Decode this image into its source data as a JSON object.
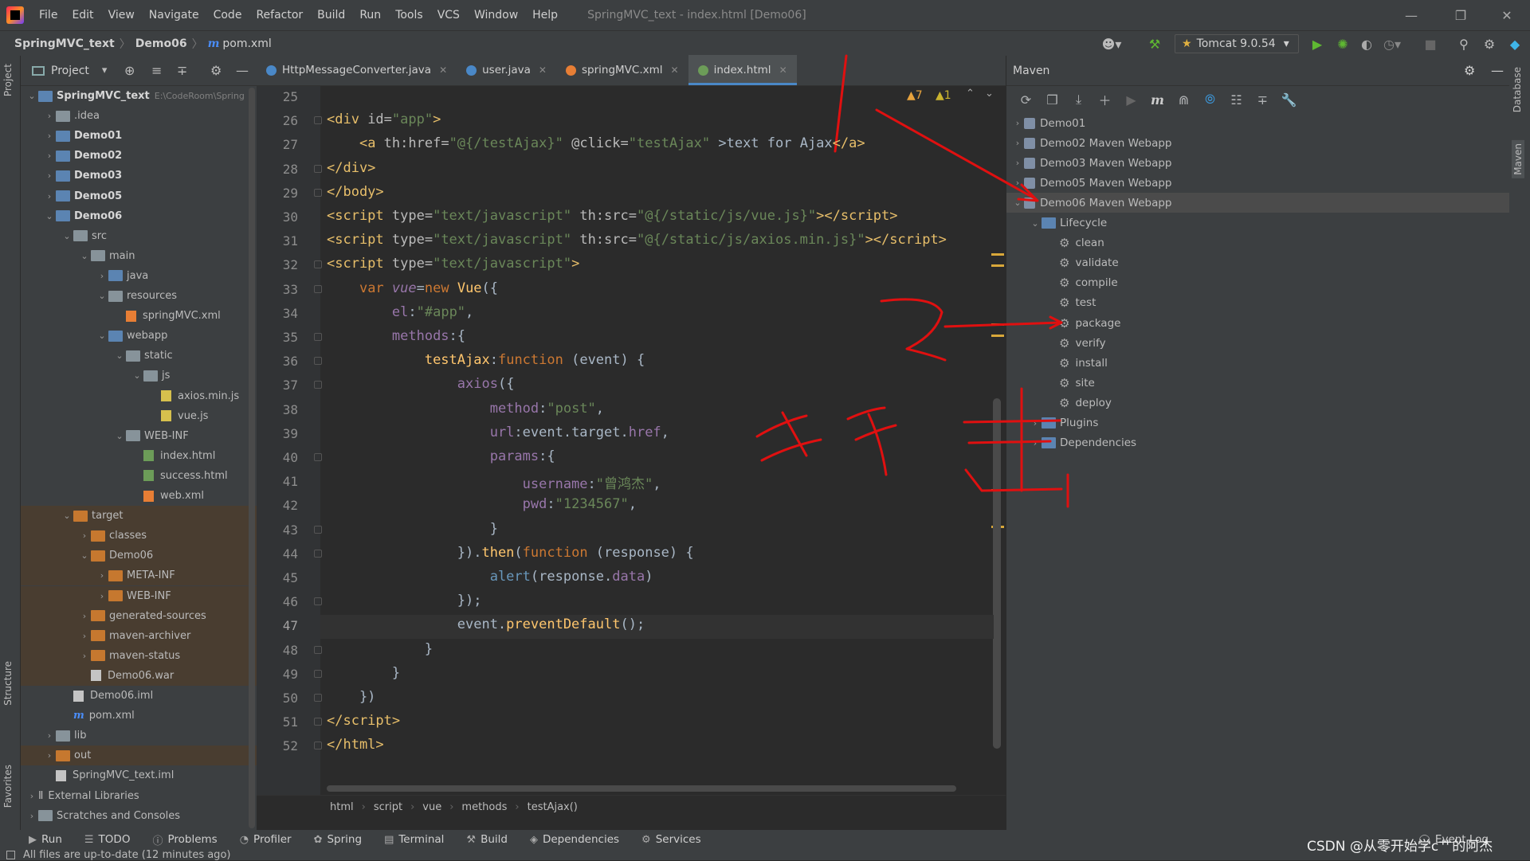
{
  "menu": {
    "items": [
      "File",
      "Edit",
      "View",
      "Navigate",
      "Code",
      "Refactor",
      "Build",
      "Run",
      "Tools",
      "VCS",
      "Window",
      "Help"
    ],
    "title": "SpringMVC_text - index.html [Demo06]"
  },
  "navbar": {
    "crumbs": [
      "SpringMVC_text",
      "Demo06",
      "pom.xml"
    ],
    "run_config": "Tomcat 9.0.54"
  },
  "project": {
    "header": "Project",
    "rows": [
      {
        "label": "SpringMVC_text",
        "extra": "E:\\CodeRoom\\Spring",
        "indent": 0,
        "arrow": "v",
        "icon": "folder-blue",
        "bold": true
      },
      {
        "label": ".idea",
        "indent": 1,
        "arrow": ">",
        "icon": "folder"
      },
      {
        "label": "Demo01",
        "indent": 1,
        "arrow": ">",
        "icon": "folder-blue",
        "bold": true
      },
      {
        "label": "Demo02",
        "indent": 1,
        "arrow": ">",
        "icon": "folder-blue",
        "bold": true
      },
      {
        "label": "Demo03",
        "indent": 1,
        "arrow": ">",
        "icon": "folder-blue",
        "bold": true
      },
      {
        "label": "Demo05",
        "indent": 1,
        "arrow": ">",
        "icon": "folder-blue",
        "bold": true
      },
      {
        "label": "Demo06",
        "indent": 1,
        "arrow": "v",
        "icon": "folder-blue",
        "bold": true
      },
      {
        "label": "src",
        "indent": 2,
        "arrow": "v",
        "icon": "folder"
      },
      {
        "label": "main",
        "indent": 3,
        "arrow": "v",
        "icon": "folder"
      },
      {
        "label": "java",
        "indent": 4,
        "arrow": ">",
        "icon": "folder-blue"
      },
      {
        "label": "resources",
        "indent": 4,
        "arrow": "v",
        "icon": "folder"
      },
      {
        "label": "springMVC.xml",
        "indent": 5,
        "arrow": "",
        "icon": "xml"
      },
      {
        "label": "webapp",
        "indent": 4,
        "arrow": "v",
        "icon": "folder-blue"
      },
      {
        "label": "static",
        "indent": 5,
        "arrow": "v",
        "icon": "folder"
      },
      {
        "label": "js",
        "indent": 6,
        "arrow": "v",
        "icon": "folder"
      },
      {
        "label": "axios.min.js",
        "indent": 7,
        "arrow": "",
        "icon": "js"
      },
      {
        "label": "vue.js",
        "indent": 7,
        "arrow": "",
        "icon": "js"
      },
      {
        "label": "WEB-INF",
        "indent": 5,
        "arrow": "v",
        "icon": "folder"
      },
      {
        "label": "index.html",
        "indent": 6,
        "arrow": "",
        "icon": "html"
      },
      {
        "label": "success.html",
        "indent": 6,
        "arrow": "",
        "icon": "html"
      },
      {
        "label": "web.xml",
        "indent": 6,
        "arrow": "",
        "icon": "xml"
      },
      {
        "label": "target",
        "indent": 2,
        "arrow": "v",
        "icon": "folder-orange",
        "excl": true
      },
      {
        "label": "classes",
        "indent": 3,
        "arrow": ">",
        "icon": "folder-orange",
        "excl": true
      },
      {
        "label": "Demo06",
        "indent": 3,
        "arrow": "v",
        "icon": "folder-orange",
        "excl": true
      },
      {
        "label": "META-INF",
        "indent": 4,
        "arrow": ">",
        "icon": "folder-orange",
        "excl": true
      },
      {
        "label": "WEB-INF",
        "indent": 4,
        "arrow": ">",
        "icon": "folder-orange",
        "excl": true
      },
      {
        "label": "generated-sources",
        "indent": 3,
        "arrow": ">",
        "icon": "folder-orange",
        "excl": true
      },
      {
        "label": "maven-archiver",
        "indent": 3,
        "arrow": ">",
        "icon": "folder-orange",
        "excl": true
      },
      {
        "label": "maven-status",
        "indent": 3,
        "arrow": ">",
        "icon": "folder-orange",
        "excl": true
      },
      {
        "label": "Demo06.war",
        "indent": 3,
        "arrow": "",
        "icon": "file",
        "excl": true
      },
      {
        "label": "Demo06.iml",
        "indent": 2,
        "arrow": "",
        "icon": "file"
      },
      {
        "label": "pom.xml",
        "indent": 2,
        "arrow": "",
        "icon": "maven"
      },
      {
        "label": "lib",
        "indent": 1,
        "arrow": ">",
        "icon": "folder"
      },
      {
        "label": "out",
        "indent": 1,
        "arrow": ">",
        "icon": "folder-orange",
        "excl": true
      },
      {
        "label": "SpringMVC_text.iml",
        "indent": 1,
        "arrow": "",
        "icon": "file"
      },
      {
        "label": "External Libraries",
        "indent": 0,
        "arrow": ">",
        "icon": "lib"
      },
      {
        "label": "Scratches and Consoles",
        "indent": 0,
        "arrow": ">",
        "icon": "folder"
      }
    ]
  },
  "tabs": [
    {
      "label": "HttpMessageConverter.java",
      "color": "#4a88c7"
    },
    {
      "label": "user.java",
      "color": "#4a88c7"
    },
    {
      "label": "springMVC.xml",
      "color": "#e77e35"
    },
    {
      "label": "index.html",
      "color": "#6c9c58",
      "active": true
    }
  ],
  "editor": {
    "inspections": {
      "warn": "7",
      "weak": "1"
    },
    "lines": [
      {
        "n": "25",
        "html": ""
      },
      {
        "n": "26",
        "html": "<span class='tag'>&lt;div </span><span class='attr'>id=</span><span class='str'>\"app\"</span><span class='tag'>&gt;</span>"
      },
      {
        "n": "27",
        "html": "    <span class='tag'>&lt;a </span><span class='attr'>th:href=</span><span class='str'>\"@{/testAjax}\"</span> <span class='attr'>@click=</span><span class='str'>\"testAjax\"</span> &gt;text for Ajax<span class='tag'>&lt;/a&gt;</span>"
      },
      {
        "n": "28",
        "html": "<span class='tag'>&lt;/div&gt;</span>"
      },
      {
        "n": "29",
        "html": "<span class='tag'>&lt;/body&gt;</span>"
      },
      {
        "n": "30",
        "html": "<span class='tag'>&lt;script </span><span class='attr'>type=</span><span class='str'>\"text/javascript\"</span> <span class='attr'>th:src=</span><span class='str'>\"@{/static/js/vue.js}\"</span><span class='tag'>&gt;&lt;/script&gt;</span>"
      },
      {
        "n": "31",
        "html": "<span class='tag'>&lt;script </span><span class='attr'>type=</span><span class='str'>\"text/javascript\"</span> <span class='attr'>th:src=</span><span class='str'>\"@{/static/js/axios.min.js}\"</span><span class='tag'>&gt;&lt;/script&gt;</span>"
      },
      {
        "n": "32",
        "html": "<span class='tag'>&lt;script </span><span class='attr'>type=</span><span class='str'>\"text/javascript\"</span><span class='tag'>&gt;</span>"
      },
      {
        "n": "33",
        "html": "    <span class='kw'>var </span><span class='ital'>vue</span>=<span class='kw'>new </span><span class='fn'>Vue</span>({"
      },
      {
        "n": "34",
        "html": "        <span class='prop'>el</span>:<span class='str'>\"#app\"</span>,"
      },
      {
        "n": "35",
        "html": "        <span class='prop'>methods</span>:{"
      },
      {
        "n": "36",
        "html": "            <span class='fn'>testAjax</span>:<span class='kw'>function </span>(event) {"
      },
      {
        "n": "37",
        "html": "                <span class='prop'>axios</span>({"
      },
      {
        "n": "38",
        "html": "                    <span class='prop'>method</span>:<span class='str'>\"post\"</span>,"
      },
      {
        "n": "39",
        "html": "                    <span class='prop'>url</span>:event.target.<span class='prop'>href</span>,"
      },
      {
        "n": "40",
        "html": "                    <span class='prop'>params</span>:{"
      },
      {
        "n": "41",
        "html": "                        <span class='prop'>username</span>:<span class='str'>\"曾鸿杰\"</span>,"
      },
      {
        "n": "42",
        "html": "                        <span class='prop'>pwd</span>:<span class='str'>\"1234567\"</span>,"
      },
      {
        "n": "43",
        "html": "                    }"
      },
      {
        "n": "44",
        "html": "                }).<span class='fn'>then</span>(<span class='kw'>function </span>(response) {"
      },
      {
        "n": "45",
        "html": "                    <span class='cn'>alert</span>(response.<span class='prop'>data</span>)"
      },
      {
        "n": "46",
        "html": "                });"
      },
      {
        "n": "47",
        "html": "                event.<span class='fn'>preventDefault</span>();"
      },
      {
        "n": "48",
        "html": "            }"
      },
      {
        "n": "49",
        "html": "        }"
      },
      {
        "n": "50",
        "html": "    })"
      },
      {
        "n": "51",
        "html": "<span class='tag'>&lt;/script&gt;</span>"
      },
      {
        "n": "52",
        "html": "<span class='tag'>&lt;/html&gt;</span>"
      }
    ],
    "breadcrumbs": [
      "html",
      "script",
      "vue",
      "methods",
      "testAjax()"
    ]
  },
  "maven": {
    "header": "Maven",
    "rows": [
      {
        "label": "Demo01",
        "indent": 0,
        "arrow": ">",
        "icon": "module"
      },
      {
        "label": "Demo02 Maven Webapp",
        "indent": 0,
        "arrow": ">",
        "icon": "module"
      },
      {
        "label": "Demo03 Maven Webapp",
        "indent": 0,
        "arrow": ">",
        "icon": "module"
      },
      {
        "label": "Demo05 Maven Webapp",
        "indent": 0,
        "arrow": ">",
        "icon": "module"
      },
      {
        "label": "Demo06 Maven Webapp",
        "indent": 0,
        "arrow": "v",
        "icon": "module",
        "sel": true
      },
      {
        "label": "Lifecycle",
        "indent": 1,
        "arrow": "v",
        "icon": "folder"
      },
      {
        "label": "clean",
        "indent": 2,
        "arrow": "",
        "icon": "gear"
      },
      {
        "label": "validate",
        "indent": 2,
        "arrow": "",
        "icon": "gear"
      },
      {
        "label": "compile",
        "indent": 2,
        "arrow": "",
        "icon": "gear"
      },
      {
        "label": "test",
        "indent": 2,
        "arrow": "",
        "icon": "gear"
      },
      {
        "label": "package",
        "indent": 2,
        "arrow": "",
        "icon": "gear"
      },
      {
        "label": "verify",
        "indent": 2,
        "arrow": "",
        "icon": "gear"
      },
      {
        "label": "install",
        "indent": 2,
        "arrow": "",
        "icon": "gear"
      },
      {
        "label": "site",
        "indent": 2,
        "arrow": "",
        "icon": "gear"
      },
      {
        "label": "deploy",
        "indent": 2,
        "arrow": "",
        "icon": "gear"
      },
      {
        "label": "Plugins",
        "indent": 1,
        "arrow": ">",
        "icon": "folder"
      },
      {
        "label": "Dependencies",
        "indent": 1,
        "arrow": ">",
        "icon": "folder"
      }
    ]
  },
  "side": {
    "left_top": "Project",
    "left_mid": "Structure",
    "left_bot": "Favorites",
    "right_top": "Database",
    "right_mid": "Maven"
  },
  "bottom": {
    "tools": [
      "Run",
      "TODO",
      "Problems",
      "Profiler",
      "Spring",
      "Terminal",
      "Build",
      "Dependencies",
      "Services"
    ],
    "event_log": "Event Log"
  },
  "status": {
    "text": "All files are up-to-date (12 minutes ago)"
  },
  "watermark": "CSDN @从零开始学c艹的阿杰"
}
